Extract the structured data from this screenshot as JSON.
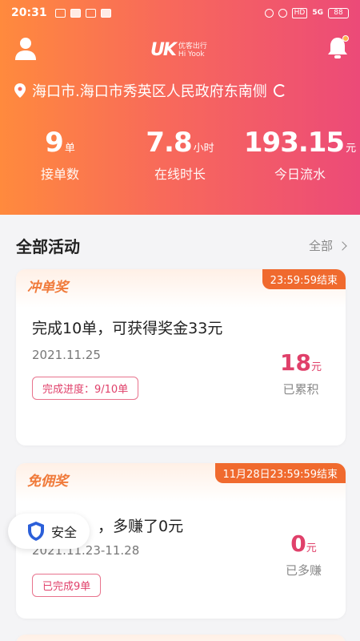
{
  "status_bar": {
    "time": "20:31",
    "battery": "88",
    "network": "5G",
    "hd": "HD"
  },
  "header": {
    "logo_mark": "UK",
    "logo_cn": "优客出行",
    "logo_en": "Hi Yook",
    "location": "海口市.海口市秀英区人民政府东南侧",
    "stats": [
      {
        "value": "9",
        "unit": "单",
        "label": "接单数"
      },
      {
        "value": "7.8",
        "unit": "小时",
        "label": "在线时长"
      },
      {
        "value": "193.15",
        "unit": "元",
        "label": "今日流水"
      }
    ]
  },
  "section": {
    "title": "全部活动",
    "more": "全部"
  },
  "cards": [
    {
      "tag": "冲单奖",
      "deadline": "23:59:59结束",
      "title": "完成10单，可获得奖金33元",
      "date": "2021.11.25",
      "pill": "完成进度：9/10单",
      "amount": "18",
      "amount_unit": "元",
      "amount_label": "已累积"
    },
    {
      "tag": "免佣奖",
      "deadline": "11月28日23:59:59结束",
      "title_visible": "，多赚了0元",
      "date": "2021.11.23-11.28",
      "pill": "已完成9单",
      "amount": "0",
      "amount_unit": "元",
      "amount_label": "已多赚"
    }
  ],
  "security_badge": {
    "label": "安全"
  },
  "icons": [
    "user-icon",
    "bell-icon",
    "pin-icon",
    "refresh-icon",
    "chevron-right-icon",
    "shield-icon"
  ],
  "colors": {
    "header_start": "#ff8a3d",
    "header_end": "#ec4a78",
    "accent": "#e0406a",
    "tag_orange": "#f06a2e"
  }
}
